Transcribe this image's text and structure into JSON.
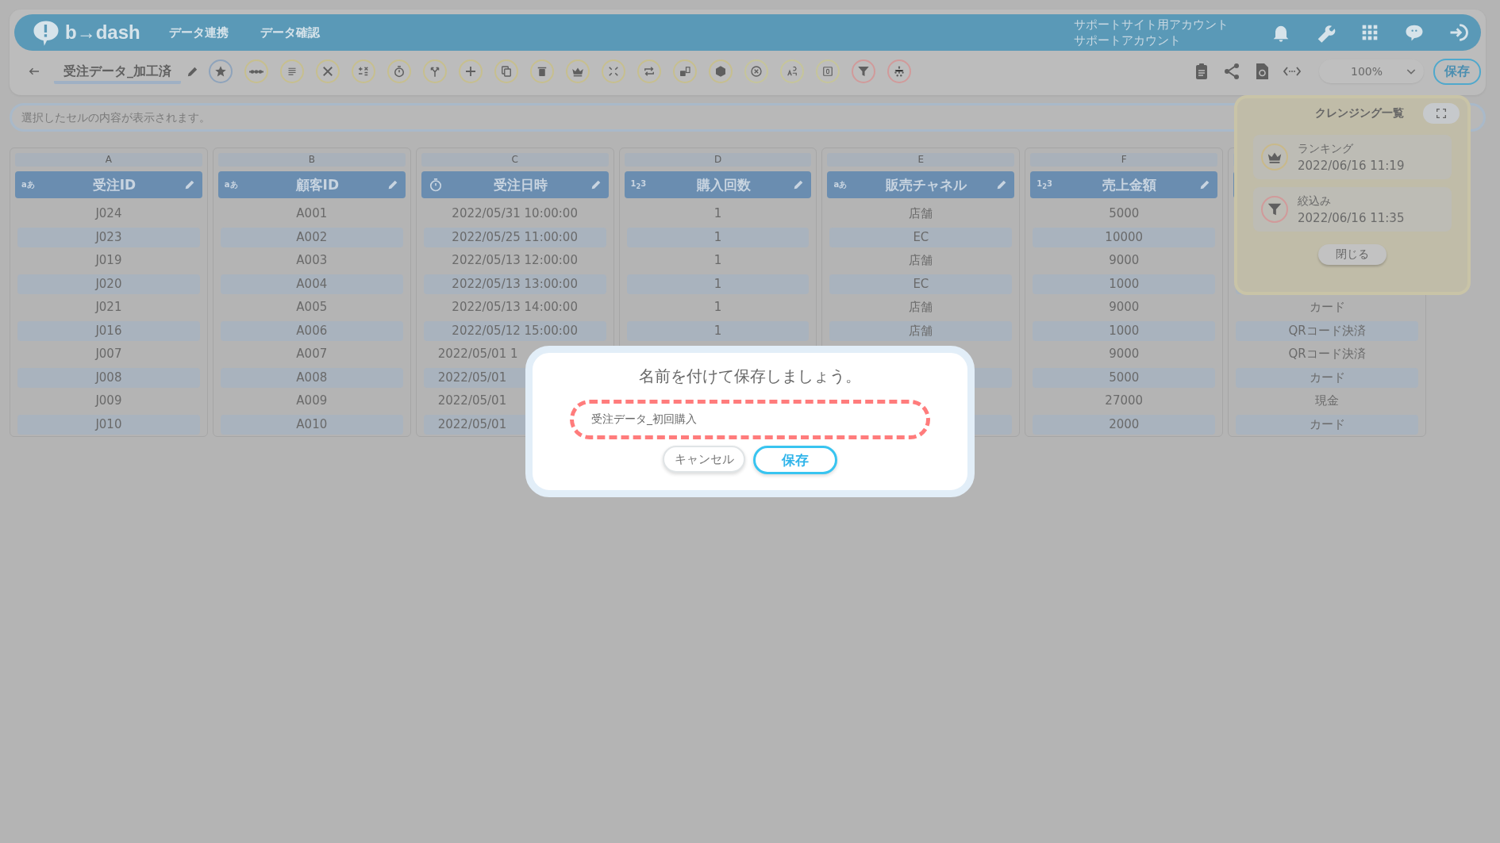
{
  "header": {
    "logo": "b→dash",
    "nav": [
      {
        "label": "データ連携"
      },
      {
        "label": "データ確認"
      }
    ],
    "account": [
      "サポートサイト用アカウント",
      "サポートアカウント"
    ]
  },
  "toolbar": {
    "title": "受注データ_加工済",
    "zoom": "100%",
    "save": "保存"
  },
  "cell_viewer": {
    "placeholder": "選択したセルの内容が表示されます。"
  },
  "columns": [
    {
      "letter": "A",
      "kind": "text",
      "type_label": "aあ",
      "name": "受注ID",
      "cells": [
        {
          "text": "J024"
        },
        {
          "text": "J023"
        },
        {
          "text": "J019"
        },
        {
          "text": "J020"
        },
        {
          "text": "J021"
        },
        {
          "text": "J016"
        },
        {
          "text": "J007"
        },
        {
          "text": "J008"
        },
        {
          "text": "J009"
        },
        {
          "text": "J010"
        }
      ]
    },
    {
      "letter": "B",
      "kind": "text",
      "type_label": "aあ",
      "name": "顧客ID",
      "cells": [
        {
          "text": "A001"
        },
        {
          "text": "A002"
        },
        {
          "text": "A003"
        },
        {
          "text": "A004"
        },
        {
          "text": "A005"
        },
        {
          "text": "A006"
        },
        {
          "text": "A007"
        },
        {
          "text": "A008"
        },
        {
          "text": "A009"
        },
        {
          "text": "A010"
        }
      ]
    },
    {
      "letter": "C",
      "kind": "datetime",
      "name": "受注日時",
      "cells": [
        {
          "text": "2022/05/31 10:00:00"
        },
        {
          "text": "2022/05/25 11:00:00"
        },
        {
          "text": "2022/05/13 12:00:00"
        },
        {
          "text": "2022/05/13 13:00:00"
        },
        {
          "text": "2022/05/13 14:00:00"
        },
        {
          "text": "2022/05/12 15:00:00"
        },
        {
          "text": "2022/05/01 1",
          "kind": "cut"
        },
        {
          "text": "2022/05/01",
          "kind": "cut"
        },
        {
          "text": "2022/05/01",
          "kind": "cut"
        },
        {
          "text": "2022/05/01",
          "kind": "cut"
        }
      ]
    },
    {
      "letter": "D",
      "kind": "number",
      "type_label": "1$_{2}$3",
      "name": "購入回数",
      "cells": [
        {
          "text": "1"
        },
        {
          "text": "1"
        },
        {
          "text": "1"
        },
        {
          "text": "1"
        },
        {
          "text": "1"
        },
        {
          "text": "1"
        },
        {},
        {},
        {},
        {}
      ]
    },
    {
      "letter": "E",
      "kind": "text",
      "type_label": "aあ",
      "name": "販売チャネル",
      "cells": [
        {
          "text": "店舗"
        },
        {
          "text": "EC"
        },
        {
          "text": "店舗"
        },
        {
          "text": "EC"
        },
        {
          "text": "店舗"
        },
        {
          "text": "店舗"
        },
        {},
        {},
        {},
        {}
      ]
    },
    {
      "letter": "F",
      "kind": "number",
      "type_label": "1$_{2}$3",
      "name": "売上金額",
      "cells": [
        {
          "text": "5000"
        },
        {
          "text": "10000"
        },
        {
          "text": "9000"
        },
        {
          "text": "1000"
        },
        {
          "text": "9000"
        },
        {
          "text": "1000"
        },
        {
          "text": "9000"
        },
        {
          "text": "5000"
        },
        {
          "text": "27000"
        },
        {
          "text": "2000"
        }
      ]
    },
    {
      "cells": [
        {},
        {},
        {},
        {},
        {
          "text": "カード"
        },
        {
          "text": "QRコード決済"
        },
        {
          "text": "QRコード決済"
        },
        {
          "text": "カード"
        },
        {
          "text": "現金"
        },
        {
          "text": "カード"
        }
      ]
    }
  ],
  "cleansing_panel": {
    "title": "クレンジング一覧",
    "items": [
      {
        "kind": "ranking",
        "name": "ランキング",
        "time": "2022/06/16 11:19"
      },
      {
        "kind": "filter",
        "name": "絞込み",
        "time": "2022/06/16 11:35"
      }
    ],
    "close": "閉じる"
  },
  "dialog": {
    "title": "名前を付けて保存しましょう。",
    "value": "受注データ_初回購入",
    "cancel": "キャンセル",
    "save": "保存"
  }
}
